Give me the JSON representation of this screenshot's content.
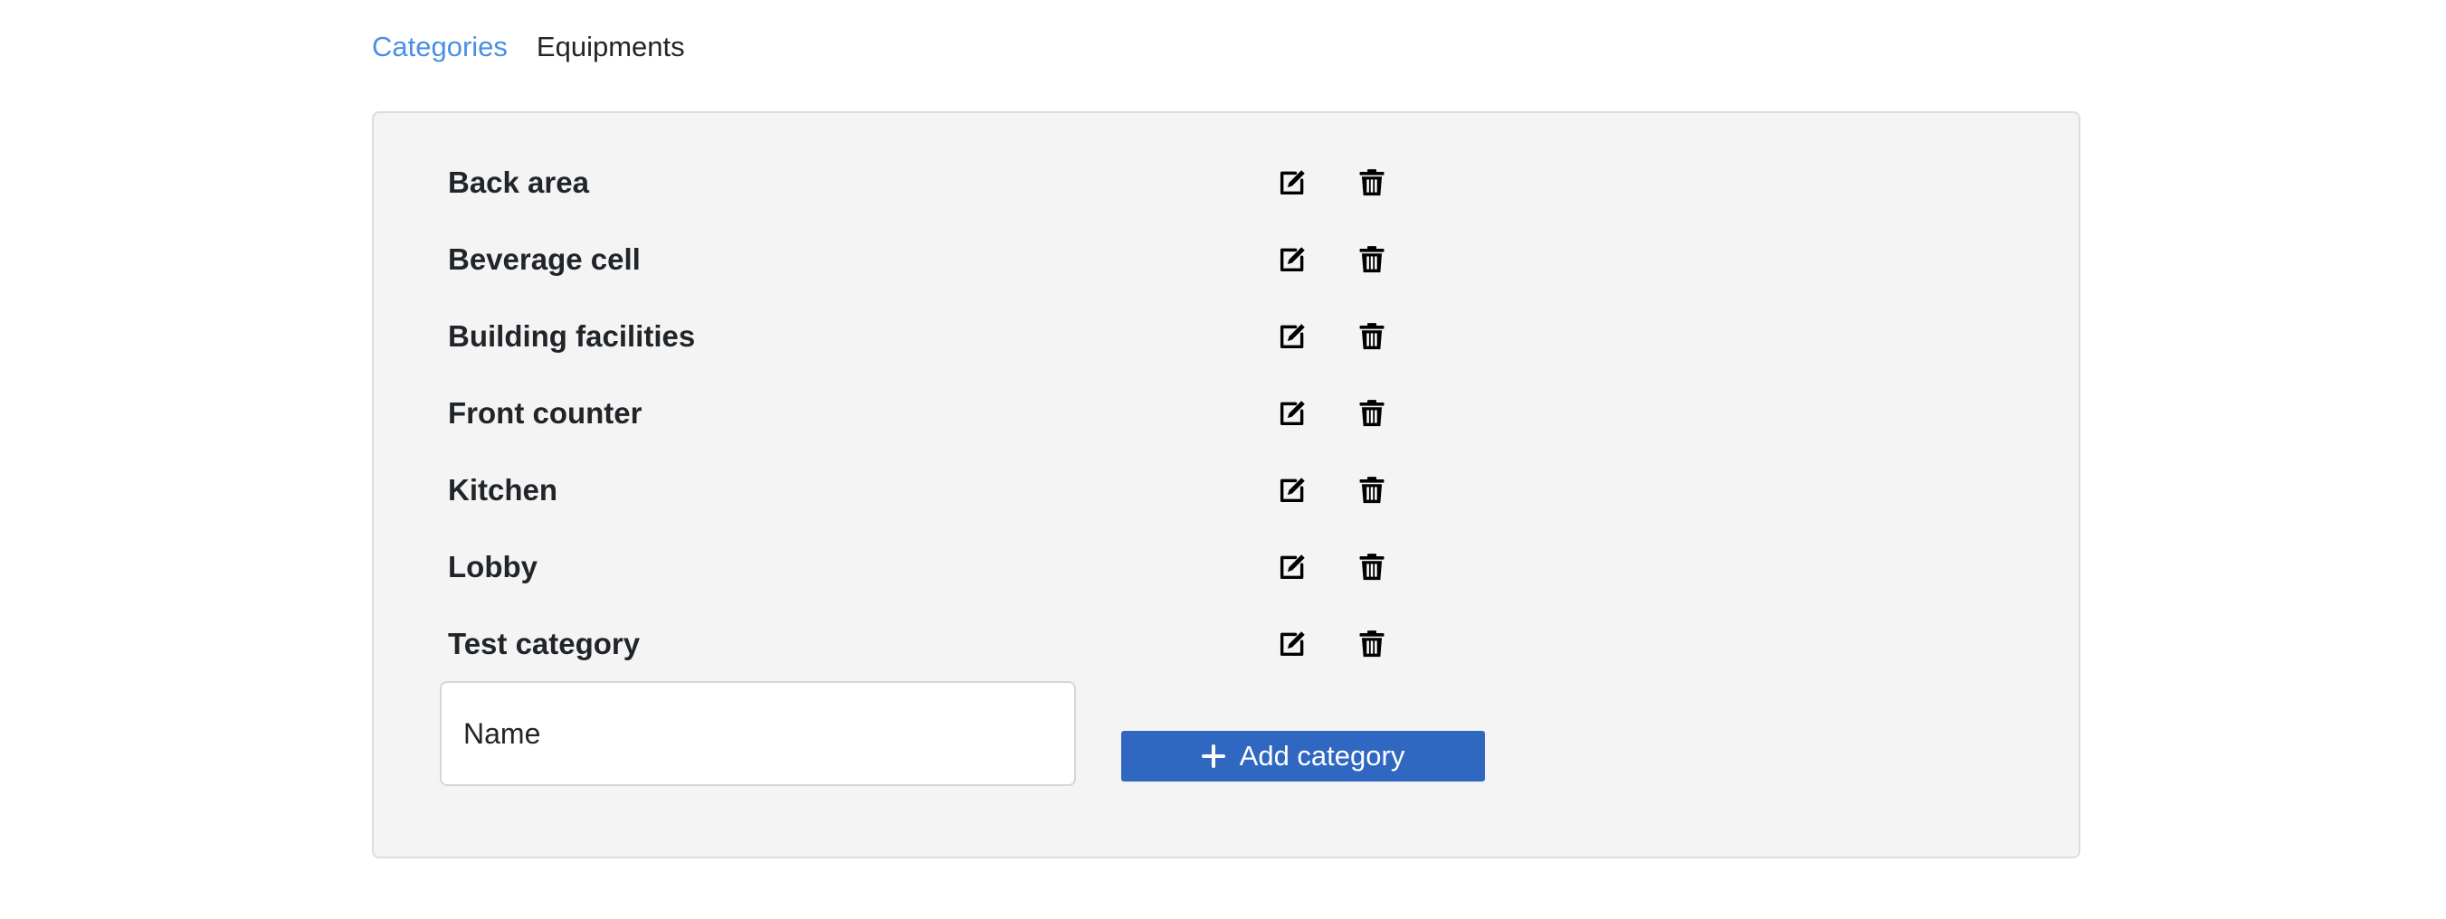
{
  "tabs": [
    {
      "label": "Categories",
      "active": true
    },
    {
      "label": "Equipments",
      "active": false
    }
  ],
  "categories": [
    {
      "name": "Back area"
    },
    {
      "name": "Beverage cell"
    },
    {
      "name": "Building facilities"
    },
    {
      "name": "Front counter"
    },
    {
      "name": "Kitchen"
    },
    {
      "name": "Lobby"
    },
    {
      "name": "Test category"
    }
  ],
  "row_icons": {
    "edit": "edit-icon",
    "delete": "trash-icon"
  },
  "form": {
    "name_placeholder": "Name",
    "name_value": "",
    "add_label": "Add category",
    "add_icon": "plus-icon"
  },
  "colors": {
    "active_tab": "#4a90e2",
    "primary_button": "#2f67c1",
    "panel_background": "#f4f4f4"
  }
}
